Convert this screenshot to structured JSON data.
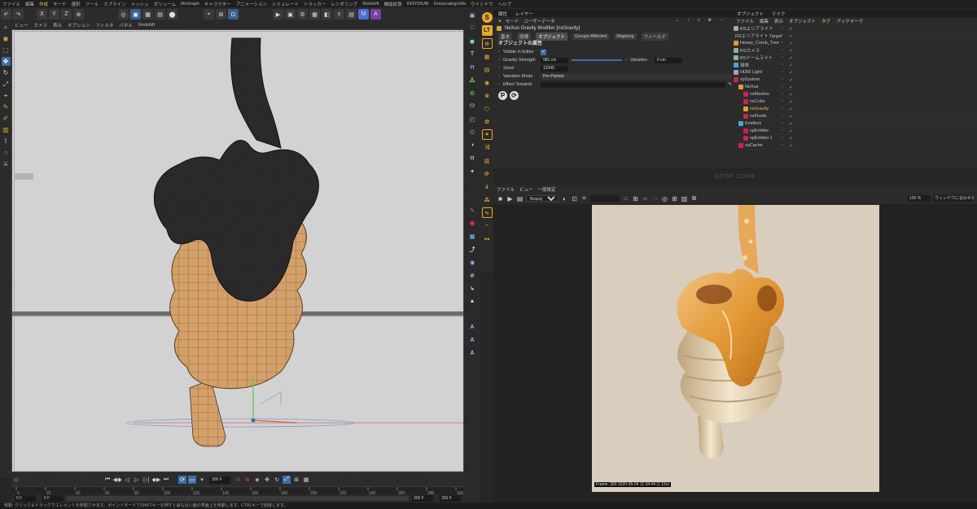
{
  "menubar": [
    "ファイル",
    "編集",
    "作成",
    "モード",
    "選択",
    "ツール",
    "スプライン",
    "メッシュ",
    "ボリューム",
    "MoGraph",
    "キャラクター",
    "アニメーション",
    "シミュレート",
    "トラッカー",
    "レンダリング",
    "Redshift",
    "機能拡張",
    "INSYDIUM",
    "Greyscalegorilla",
    "ウインドウ",
    "ヘルプ"
  ],
  "menubar_active": "作成",
  "viewport_menu": [
    "ビュー",
    "カメラ",
    "表示",
    "オプション",
    "フィルタ",
    "パネル",
    "Redshift"
  ],
  "timeline": {
    "current_frame": "300 F",
    "start": "0 F",
    "start2": "0 F",
    "end": "300 F",
    "end2": "300 F",
    "ticks": [
      "0",
      "20",
      "40",
      "60",
      "80",
      "100",
      "120",
      "140",
      "160",
      "180",
      "200",
      "220",
      "240",
      "260",
      "280",
      "300"
    ]
  },
  "status": "移動: クリック＆ドラッグでエレメントを移動させます。ポイントモードでSHIFTキーを押すと最も近い面の表面上を移動します。CTRLキーで削除します。",
  "attributes": {
    "tabs": [
      "属性",
      "レイヤー"
    ],
    "menu": [
      "モード",
      "ユーザーデータ"
    ],
    "title": "NeXus Gravity Modifier [nxGravity]",
    "subtabs": [
      "基本",
      "座標",
      "オブジェクト",
      "Groups Affected",
      "Mapping",
      "フィールド"
    ],
    "active_subtab": "オブジェクト",
    "section": "オブジェクトの属性",
    "visible_label": "Visible in Editor",
    "gravity_label": "Gravity Strength",
    "gravity_value": "981 cm",
    "variation_label": "Variation",
    "variation_value": "0 cm",
    "seed_label": "Seed",
    "seed_value": "12345",
    "variation_mode_label": "Variation Mode",
    "variation_mode_value": "Per-Particle",
    "effect_towards_label": "Effect Towards"
  },
  "objects": {
    "tabs": [
      "オブジェクト",
      "テイク"
    ],
    "menu": [
      "ファイル",
      "編集",
      "表示",
      "オブジェクト",
      "タグ",
      "ブックマーク"
    ],
    "items": [
      {
        "name": "RSエリアライト",
        "indent": 0,
        "color": "#9aa"
      },
      {
        "name": "RSエリアライト.Target",
        "indent": 0,
        "color": "#9aa"
      },
      {
        "name": "Honey_Comb_Tree",
        "indent": 0,
        "color": "#e09a3a"
      },
      {
        "name": "RSカメラ",
        "indent": 0,
        "color": "#9aa"
      },
      {
        "name": "RSドームライト",
        "indent": 0,
        "color": "#9aa"
      },
      {
        "name": "球体",
        "indent": 0,
        "color": "#4aa3e0"
      },
      {
        "name": "HDRI Light",
        "indent": 0,
        "color": "#9aa"
      },
      {
        "name": "xpSystem",
        "indent": 0,
        "color": "#c25"
      },
      {
        "name": "NeXus",
        "indent": 1,
        "color": "#e0a030"
      },
      {
        "name": "nxMesher",
        "indent": 2,
        "color": "#c25"
      },
      {
        "name": "nxColor",
        "indent": 2,
        "color": "#c25"
      },
      {
        "name": "nxGravity",
        "indent": 2,
        "color": "#e0a030",
        "active": true
      },
      {
        "name": "nxFluids",
        "indent": 2,
        "color": "#c25"
      },
      {
        "name": "Emitters",
        "indent": 1,
        "color": "#4aa3e0"
      },
      {
        "name": "xpEmitter",
        "indent": 2,
        "color": "#c25"
      },
      {
        "name": "xpEmitter.1",
        "indent": 2,
        "color": "#c25"
      },
      {
        "name": "xpCache",
        "indent": 1,
        "color": "#c25"
      }
    ]
  },
  "dropzone": "DROP ZONE",
  "render_view": {
    "menu": [
      "ファイル",
      "ビュー",
      "一般設定"
    ],
    "aov": "Beauty",
    "zoom": "100 %",
    "fit": "ウィンドウに合わせる",
    "frame_info": "Frame: 300  2020-05-04  11:34:44  (1.15s)"
  },
  "colors": {
    "accent": "#3c6ea8",
    "active_menu": "#e9c15a",
    "wood": "#d4a066",
    "honey": "#e3932a"
  }
}
